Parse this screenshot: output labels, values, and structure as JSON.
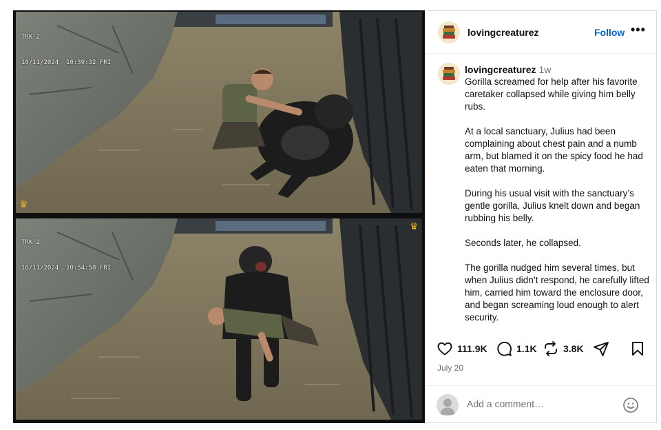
{
  "post": {
    "username": "lovingcreaturez",
    "follow_label": "Follow",
    "more_label": "•••",
    "caption_username": "lovingcreaturez",
    "time_ago": "1w",
    "caption": [
      "Gorilla screamed for help after his favorite caretaker collapsed while giving him belly rubs.",
      "At a local sanctuary, Julius had been complaining about chest pain and a numb arm, but blamed it on the spicy food he had eaten that morning.",
      "During his usual visit with the sanctuary’s gentle gorilla, Julius knelt down and began rubbing his belly.",
      "Seconds later, he collapsed.",
      "The gorilla nudged him several times, but when Julius didn’t respond, he carefully lifted him, carried him toward the enclosure door, and began screaming loud enough to alert security."
    ],
    "likes": "111.9K",
    "comments": "1.1K",
    "reposts": "3.8K",
    "date": "July 20",
    "comment_placeholder": "Add a comment…"
  },
  "media": {
    "frames": [
      {
        "cam": "TRK 2",
        "timestamp": "10/11/2024  10:39:32 FRI"
      },
      {
        "cam": "TRK 2",
        "timestamp": "10/11/2024  10:54:58 FRI"
      }
    ]
  },
  "icons": {
    "like": "heart-icon",
    "comment": "comment-bubble-icon",
    "repost": "repost-icon",
    "share": "paper-plane-icon",
    "save": "bookmark-icon",
    "emoji": "smiley-icon",
    "crown": "crown-icon"
  },
  "colors": {
    "follow": "#0064e0",
    "muted": "#737373",
    "crown": "#e9b424"
  }
}
